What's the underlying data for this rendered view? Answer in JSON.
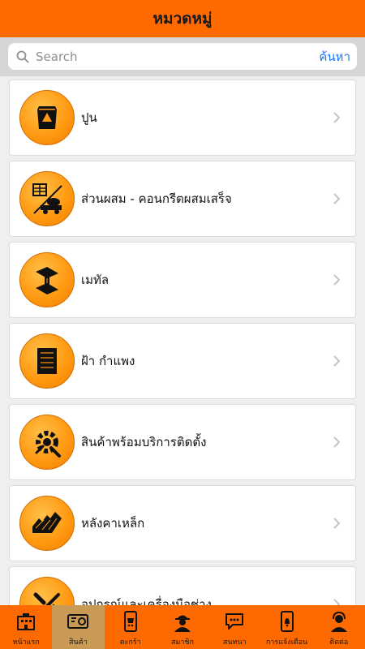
{
  "header": {
    "title": "หมวดหมู่"
  },
  "search": {
    "placeholder": "Search",
    "button_label": "ค้นหา"
  },
  "categories": [
    {
      "label": "ปูน",
      "icon": "cement-bag-icon"
    },
    {
      "label": "ส่วนผสม - คอนกรีตผสมเสร็จ",
      "icon": "concrete-mixer-icon"
    },
    {
      "label": "เมทัล",
      "icon": "steel-beam-icon"
    },
    {
      "label": "ฝ้า กำแพง",
      "icon": "wall-panel-icon"
    },
    {
      "label": "สินค้าพร้อมบริการติดตั้ง",
      "icon": "install-service-icon"
    },
    {
      "label": "หลังคาเหล็ก",
      "icon": "metal-roof-icon"
    },
    {
      "label": "อุปกรณ์และเครื่องมือช่าง",
      "icon": "tools-icon"
    }
  ],
  "tabs": [
    {
      "label": "หน้าแรก",
      "icon": "home-building-icon"
    },
    {
      "label": "สินค้า",
      "icon": "products-icon",
      "active": true
    },
    {
      "label": "ตะกร้า",
      "icon": "cart-phone-icon"
    },
    {
      "label": "สมาชิก",
      "icon": "member-worker-icon"
    },
    {
      "label": "สนทนา",
      "icon": "chat-icon"
    },
    {
      "label": "การแจ้งเตือน",
      "icon": "notification-phone-icon"
    },
    {
      "label": "ติดต่อ",
      "icon": "contact-support-icon"
    }
  ],
  "colors": {
    "brand": "#ff6a00",
    "active_tab": "#c99a55",
    "link": "#1a78ff"
  }
}
